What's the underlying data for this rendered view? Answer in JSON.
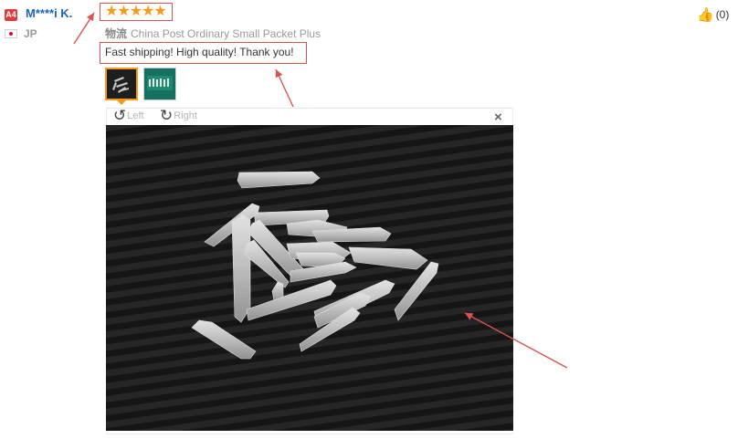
{
  "reviewer": {
    "level_badge": "A4",
    "name": "M****i K.",
    "country": "JP"
  },
  "review": {
    "rating": 5,
    "stars_text": "★★★★★",
    "shipping_cn": "物流",
    "shipping_method": "China Post Ordinary Small Packet Plus",
    "feedback_text": "Fast shipping! High quality! Thank you!"
  },
  "helpful": {
    "count_text": "(0)"
  },
  "viewer": {
    "rotate_left_label": "Left",
    "rotate_right_label": "Right",
    "close_label": "×"
  },
  "colors": {
    "accent_orange": "#f79a1a",
    "name_blue": "#1a66b3",
    "annotation_red": "#d9534f"
  }
}
